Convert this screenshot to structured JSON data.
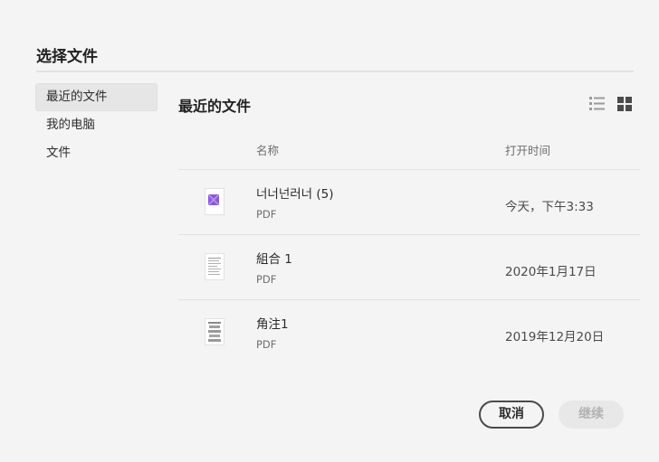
{
  "dialog": {
    "title": "选择文件"
  },
  "sidebar": {
    "items": [
      {
        "label": "最近的文件",
        "active": true
      },
      {
        "label": "我的电脑",
        "active": false
      },
      {
        "label": "文件",
        "active": false
      }
    ]
  },
  "main": {
    "title": "最近的文件",
    "view_modes": {
      "list_icon": "list-view-icon",
      "grid_icon": "grid-view-icon",
      "selected": "grid"
    },
    "columns": {
      "name": "名称",
      "opened": "打开时间"
    },
    "files": [
      {
        "name": "너너넌러너 (5)",
        "type": "PDF",
        "opened": "今天，下午3:33",
        "thumb": "pdf-thumbnail-purple"
      },
      {
        "name": "組合 1",
        "type": "PDF",
        "opened": "2020年1月17日",
        "thumb": "pdf-thumbnail-text"
      },
      {
        "name": "角注1",
        "type": "PDF",
        "opened": "2019年12月20日",
        "thumb": "pdf-thumbnail-scan"
      }
    ]
  },
  "footer": {
    "cancel_label": "取消",
    "continue_label": "继续"
  },
  "colors": {
    "accent_thumb": "#8e5bd6",
    "divider": "#e1e1e1",
    "disabled": "#b3b3b3"
  }
}
